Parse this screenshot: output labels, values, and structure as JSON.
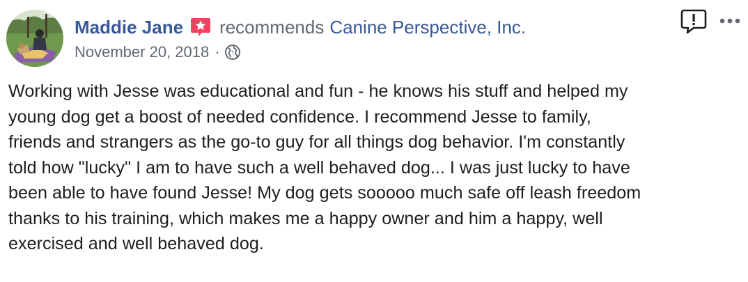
{
  "post": {
    "author_name": "Maddie Jane",
    "action_text": "recommends",
    "page_name": "Canine Perspective, Inc.",
    "date": "November 20, 2018",
    "separator": "·",
    "privacy_icon": "globe-icon",
    "body": "Working with Jesse was educational and fun - he knows his stuff and helped my\nyoung dog get a boost of needed confidence. I recommend Jesse to family,\nfriends and strangers as the go-to guy for all things dog behavior. I'm constantly\ntold how \"lucky\" I am to have such a well behaved dog... I was just lucky to have\nbeen able to have found Jesse! My dog gets sooooo much safe off leash freedom\nthanks to his training, which makes me a happy owner and him a happy, well\nexercised and well behaved dog."
  },
  "icons": {
    "recommendation_badge": "recommendation-star-icon",
    "report": "report-icon",
    "more": "more-options-icon"
  },
  "colors": {
    "link": "#385898",
    "secondary_text": "#606770",
    "body_text": "#1c1e21",
    "badge": "#f3425f"
  }
}
